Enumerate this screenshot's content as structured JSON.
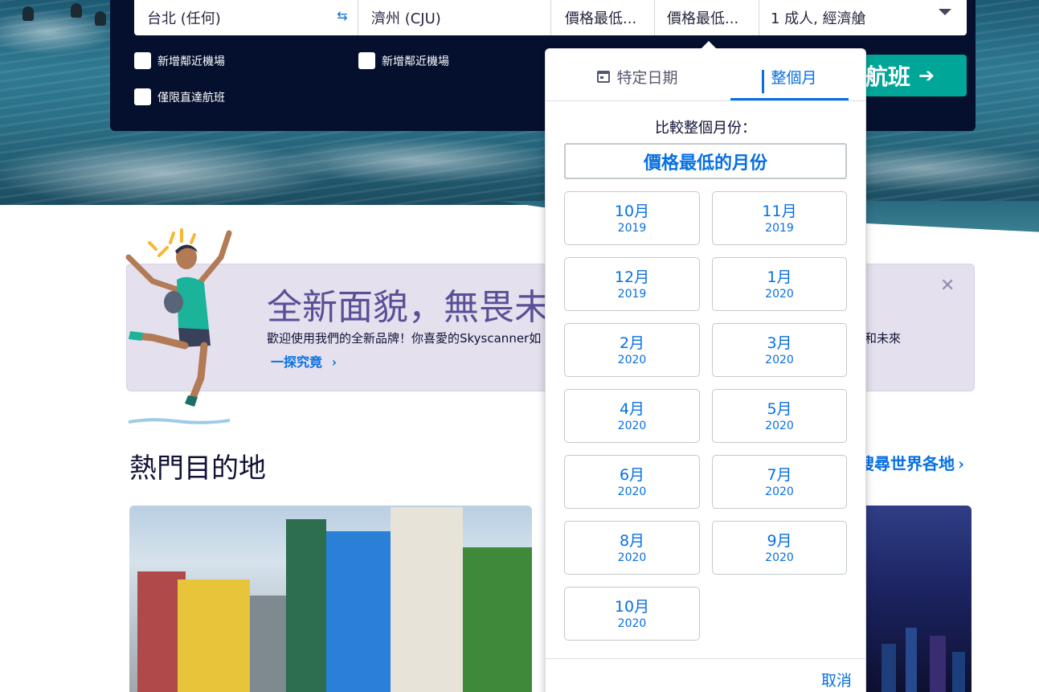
{
  "search": {
    "from_value": "台北 (任何)",
    "to_value": "濟州 (CJU)",
    "depart_value": "價格最低...",
    "return_value": "價格最低...",
    "cabin_value": "1 成人, 經濟艙",
    "add_nearby_from_label": "新增鄰近機場",
    "add_nearby_to_label": "新增鄰近機場",
    "direct_only_label": "僅限直達航班",
    "search_button_label": "航班"
  },
  "date_picker": {
    "tabs": [
      {
        "label": "特定日期",
        "active": false
      },
      {
        "label": "整個月",
        "active": true
      }
    ],
    "compare_label": "比較整個月份：",
    "cheapest_month_label": "價格最低的月份",
    "months": [
      {
        "month": "10月",
        "year": "2019"
      },
      {
        "month": "11月",
        "year": "2019"
      },
      {
        "month": "12月",
        "year": "2019"
      },
      {
        "month": "1月",
        "year": "2020"
      },
      {
        "month": "2月",
        "year": "2020"
      },
      {
        "month": "3月",
        "year": "2020"
      },
      {
        "month": "4月",
        "year": "2020"
      },
      {
        "month": "5月",
        "year": "2020"
      },
      {
        "month": "6月",
        "year": "2020"
      },
      {
        "month": "7月",
        "year": "2020"
      },
      {
        "month": "8月",
        "year": "2020"
      },
      {
        "month": "9月",
        "year": "2020"
      },
      {
        "month": "10月",
        "year": "2020"
      }
    ],
    "cancel_label": "取消"
  },
  "banner": {
    "title": "全新面貌，無畏未",
    "text": "歡迎使用我們的全新品牌！你喜愛的Skyscanner如",
    "text_tail": "和未來",
    "link_label": "一探究竟"
  },
  "destinations": {
    "title": "熱門目的地",
    "explore_label": "搜尋世界各地"
  },
  "colors": {
    "brand_blue": "#0770e3",
    "navy": "#04102d",
    "teal": "#00a698",
    "banner_bg": "#e4e0ee"
  },
  "icons": [
    "swap-icon",
    "chevron-down-icon",
    "calendar-icon",
    "bar-chart-icon",
    "arrow-right-icon",
    "close-icon",
    "chevron-right-icon"
  ]
}
